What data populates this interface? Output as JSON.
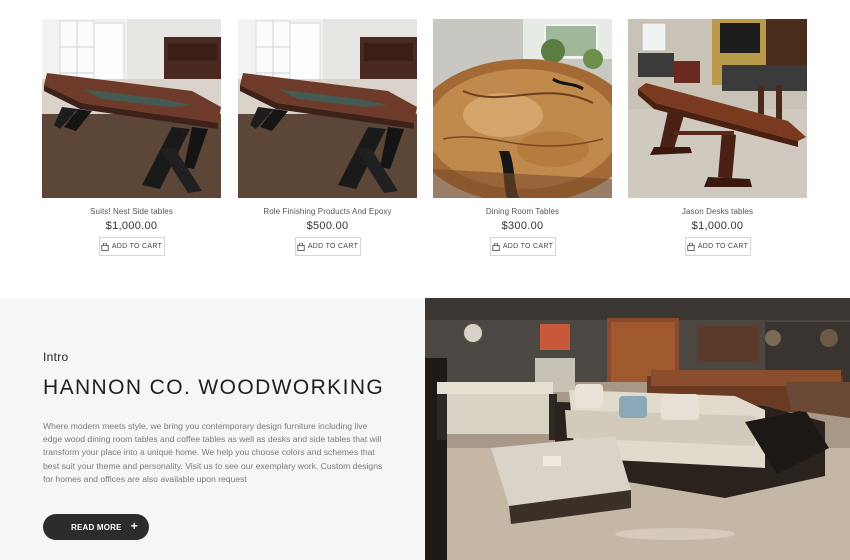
{
  "products": [
    {
      "name": "Suits! Nest Side tables",
      "price": "$1,000.00",
      "cart_label": "ADD TO CART",
      "image": "walnut-table-x-legs"
    },
    {
      "name": "Role Finishing Products And Epoxy",
      "price": "$500.00",
      "cart_label": "ADD TO CART",
      "image": "walnut-table-x-legs"
    },
    {
      "name": "Dining Room Tables",
      "price": "$300.00",
      "cart_label": "ADD TO CART",
      "image": "round-live-edge-tabletop"
    },
    {
      "name": "Jason Desks tables",
      "price": "$1,000.00",
      "cart_label": "ADD TO CART",
      "image": "trestle-table-kitchen"
    }
  ],
  "intro": {
    "kicker": "Intro",
    "heading": "HANNON CO. WOODWORKING",
    "body": "Where modern meets style, we bring you contemporary design furniture including live edge wood dining room tables and coffee tables as well as desks and side tables that will transform your place into a unique home. We help you choose colors and schemes that best suit your theme and personality. Visit us to see our exemplary work. Custom designs for homes and offices are also available upon request",
    "button_label": "READ MORE",
    "button_icon": "+"
  },
  "showroom_image": "furniture-showroom-sofa",
  "icons": {
    "cart": "shopping-bag-icon"
  },
  "colors": {
    "button_bg": "#2c2c2c",
    "intro_bg": "#f6f6f6",
    "text_muted": "#7a7a7a"
  }
}
